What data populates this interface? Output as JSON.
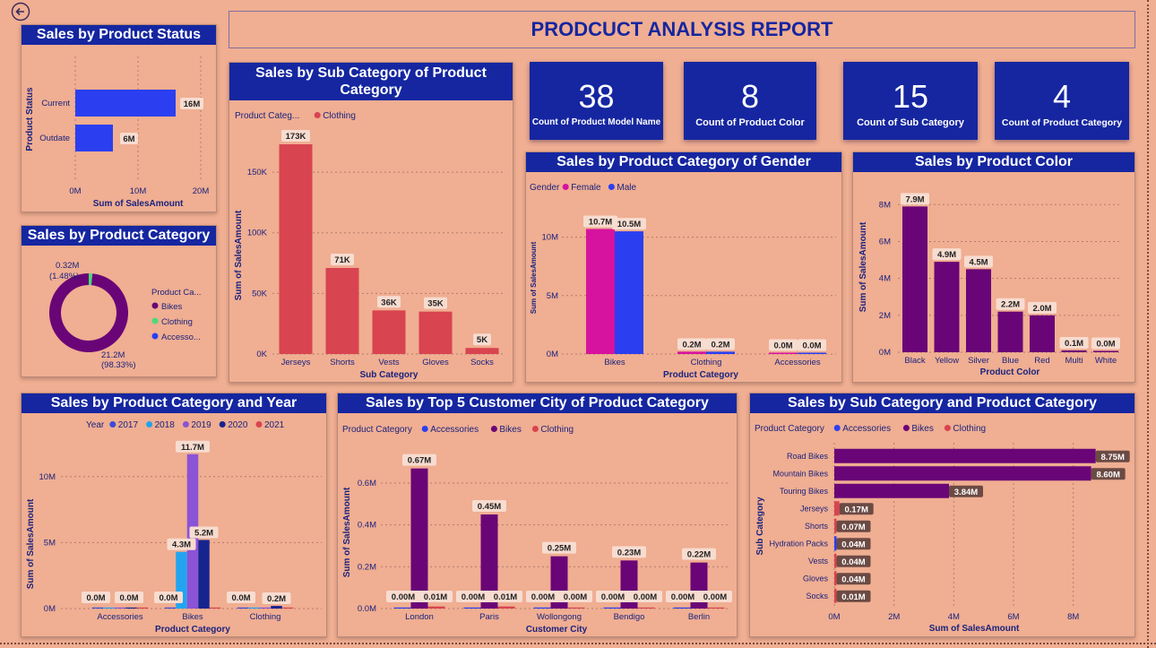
{
  "report_title": "PRODCUCT ANALYSIS REPORT",
  "icons": {
    "back": "back-arrow-icon"
  },
  "kpis": [
    {
      "value": "38",
      "label": "Count of Product Model Name"
    },
    {
      "value": "8",
      "label": "Count of Product Color"
    },
    {
      "value": "15",
      "label": "Count of Sub Category"
    },
    {
      "value": "4",
      "label": "Count of Product Category"
    }
  ],
  "colors": {
    "bg": "#f0ae92",
    "title_bar": "#1526a0",
    "blue": "#2b3ff0",
    "red": "#d8444f",
    "purple": "#6a0577",
    "pink": "#d6139e",
    "green": "#4cd97b"
  },
  "chart_data": [
    {
      "id": "status",
      "type": "bar",
      "orientation": "horizontal",
      "title": "Sales by Product Status",
      "xlabel": "Sum of SalesAmount",
      "ylabel": "Product Status",
      "categories": [
        "Current",
        "Outdate"
      ],
      "values": [
        16000000,
        6000000
      ],
      "data_labels": [
        "16M",
        "6M"
      ],
      "xlim": [
        0,
        20000000
      ],
      "xticks": [
        "0M",
        "10M",
        "20M"
      ],
      "grid": true
    },
    {
      "id": "category_donut",
      "type": "pie",
      "title": "Sales by Product Category",
      "legend_title": "Product Ca...",
      "legend": [
        "Bikes",
        "Clothing",
        "Accesso..."
      ],
      "values": [
        21200000,
        320000,
        0
      ],
      "labels": [
        {
          "value": "21.2M",
          "pct": "(98.33%)"
        },
        {
          "value": "0.32M",
          "pct": "(1.48%)"
        }
      ],
      "legend_placement": "right"
    },
    {
      "id": "subcat_clothing",
      "type": "bar",
      "title": "Sales by Sub Category of Product Category",
      "legend_title": "Product Categ...",
      "legend": [
        "Clothing"
      ],
      "categories": [
        "Jerseys",
        "Shorts",
        "Vests",
        "Gloves",
        "Socks"
      ],
      "values": [
        173000,
        71000,
        36000,
        35000,
        5000
      ],
      "data_labels": [
        "173K",
        "71K",
        "36K",
        "35K",
        "5K"
      ],
      "xlabel": "Sub Category",
      "ylabel": "Sum of SalesAmount",
      "ylim": [
        0,
        190000
      ],
      "yticks": [
        {
          "v": 0,
          "t": "0K"
        },
        {
          "v": 50000,
          "t": "50K"
        },
        {
          "v": 100000,
          "t": "100K"
        },
        {
          "v": 150000,
          "t": "150K"
        }
      ],
      "grid": true
    },
    {
      "id": "gender",
      "type": "bar",
      "title": "Sales by Product Category of Gender",
      "legend_title": "Gender",
      "categories": [
        "Bikes",
        "Clothing",
        "Accessories"
      ],
      "series": [
        {
          "name": "Female",
          "values": [
            10700000,
            200000,
            0
          ],
          "labels": [
            "10.7M",
            "0.2M",
            "0.0M"
          ]
        },
        {
          "name": "Male",
          "values": [
            10500000,
            200000,
            0
          ],
          "labels": [
            "10.5M",
            "0.2M",
            "0.0M"
          ]
        }
      ],
      "xlabel": "Product Category",
      "ylabel": "Sum of SalesAmount",
      "ylim": [
        0,
        12500000
      ],
      "yticks": [
        {
          "v": 0,
          "t": "0M"
        },
        {
          "v": 5000000,
          "t": "5M"
        },
        {
          "v": 10000000,
          "t": "10M"
        }
      ],
      "grid": true
    },
    {
      "id": "color",
      "type": "bar",
      "title": "Sales by Product Color",
      "categories": [
        "Black",
        "Yellow",
        "Silver",
        "Blue",
        "Red",
        "Multi",
        "White"
      ],
      "values": [
        7900000,
        4900000,
        4500000,
        2200000,
        2000000,
        100000,
        0
      ],
      "data_labels": [
        "7.9M",
        "4.9M",
        "4.5M",
        "2.2M",
        "2.0M",
        "0.1M",
        "0.0M"
      ],
      "xlabel": "Product Color",
      "ylabel": "Sum of SalesAmount",
      "ylim": [
        0,
        8500000
      ],
      "yticks": [
        {
          "v": 0,
          "t": "0M"
        },
        {
          "v": 2000000,
          "t": "2M"
        },
        {
          "v": 4000000,
          "t": "4M"
        },
        {
          "v": 6000000,
          "t": "6M"
        },
        {
          "v": 8000000,
          "t": "8M"
        }
      ],
      "grid": true
    },
    {
      "id": "year",
      "type": "bar",
      "title": "Sales by Product Category and Year",
      "legend_title": "Year",
      "categories": [
        "Accessories",
        "Bikes",
        "Clothing"
      ],
      "series": [
        {
          "name": "2017",
          "values": [
            0,
            0,
            0
          ]
        },
        {
          "name": "2018",
          "values": [
            0,
            4300000,
            0
          ]
        },
        {
          "name": "2019",
          "values": [
            0,
            11700000,
            0
          ]
        },
        {
          "name": "2020",
          "values": [
            0,
            5200000,
            200000
          ]
        },
        {
          "name": "2021",
          "values": [
            0,
            0,
            0
          ]
        }
      ],
      "data_labels": [
        {
          "cat": 0,
          "series": 0,
          "text": "0.0M"
        },
        {
          "cat": 0,
          "series": 3,
          "text": "0.0M"
        },
        {
          "cat": 1,
          "series": 0,
          "text": "0.0M"
        },
        {
          "cat": 1,
          "series": 1,
          "text": "4.3M"
        },
        {
          "cat": 1,
          "series": 2,
          "text": "11.7M"
        },
        {
          "cat": 1,
          "series": 3,
          "text": "5.2M"
        },
        {
          "cat": 2,
          "series": 0,
          "text": "0.0M"
        },
        {
          "cat": 2,
          "series": 3,
          "text": "0.2M"
        }
      ],
      "xlabel": "Product Category",
      "ylabel": "Sum of SalesAmount",
      "ylim": [
        0,
        12500000
      ],
      "yticks": [
        {
          "v": 0,
          "t": "0M"
        },
        {
          "v": 5000000,
          "t": "5M"
        },
        {
          "v": 10000000,
          "t": "10M"
        }
      ],
      "grid": true
    },
    {
      "id": "city",
      "type": "bar",
      "title": "Sales by Top 5 Customer City of Product Category",
      "legend_title": "Product Category",
      "categories": [
        "London",
        "Paris",
        "Wollongong",
        "Bendigo",
        "Berlin"
      ],
      "series": [
        {
          "name": "Accessories",
          "values": [
            0,
            0,
            0,
            0,
            0
          ],
          "labels": [
            "0.00M",
            "0.00M",
            "0.00M",
            "0.00M",
            "0.00M"
          ]
        },
        {
          "name": "Bikes",
          "values": [
            670000,
            450000,
            250000,
            230000,
            220000
          ],
          "labels": [
            "0.67M",
            "0.45M",
            "0.25M",
            "0.23M",
            "0.22M"
          ]
        },
        {
          "name": "Clothing",
          "values": [
            10000,
            10000,
            0,
            0,
            0
          ],
          "labels": [
            "0.01M",
            "0.01M",
            "0.00M",
            "0.00M",
            "0.00M"
          ]
        }
      ],
      "xlabel": "Customer City",
      "ylabel": "Sum of SalesAmount",
      "ylim": [
        0,
        0.72
      ],
      "yticks": [
        {
          "v": 0,
          "t": "0.0M"
        },
        {
          "v": 200000,
          "t": "0.2M"
        },
        {
          "v": 400000,
          "t": "0.4M"
        },
        {
          "v": 600000,
          "t": "0.6M"
        }
      ],
      "grid": true
    },
    {
      "id": "subcat_hbar",
      "type": "bar",
      "orientation": "horizontal",
      "title": "Sales by Sub Category and Product Category",
      "legend_title": "Product Category",
      "legend": [
        "Accessories",
        "Bikes",
        "Clothing"
      ],
      "categories": [
        "Road Bikes",
        "Mountain Bikes",
        "Touring Bikes",
        "Jerseys",
        "Shorts",
        "Hydration Packs",
        "Vests",
        "Gloves",
        "Socks"
      ],
      "category_group": [
        "Bikes",
        "Bikes",
        "Bikes",
        "Clothing",
        "Clothing",
        "Accessories",
        "Clothing",
        "Clothing",
        "Clothing"
      ],
      "values": [
        8750000,
        8600000,
        3840000,
        170000,
        70000,
        40000,
        40000,
        40000,
        10000
      ],
      "data_labels": [
        "8.75M",
        "8.60M",
        "3.84M",
        "0.17M",
        "0.07M",
        "0.04M",
        "0.04M",
        "0.04M",
        "0.01M"
      ],
      "xlabel": "Sum of SalesAmount",
      "ylabel": "Sub Category",
      "xlim": [
        0,
        9000000
      ],
      "xticks": [
        {
          "v": 0,
          "t": "0M"
        },
        {
          "v": 2000000,
          "t": "2M"
        },
        {
          "v": 4000000,
          "t": "4M"
        },
        {
          "v": 6000000,
          "t": "6M"
        },
        {
          "v": 8000000,
          "t": "8M"
        }
      ],
      "grid": true
    }
  ]
}
